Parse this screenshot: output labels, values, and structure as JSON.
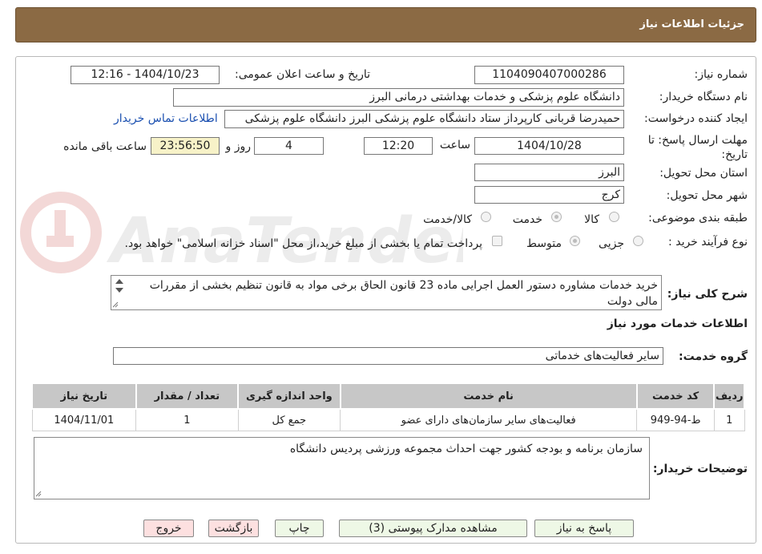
{
  "header": {
    "title": "جزئیات اطلاعات نیاز"
  },
  "form": {
    "need_number": {
      "label": "شماره نیاز:",
      "value": "1104090407000286"
    },
    "announce": {
      "label": "تاریخ و ساعت اعلان عمومی:",
      "value": "1404/10/23 - 12:16"
    },
    "buyer_org": {
      "label": "نام دستگاه خریدار:",
      "value": "دانشگاه علوم پزشکی و خدمات بهداشتی  درمانی البرز"
    },
    "requester": {
      "label": "ایجاد کننده درخواست:",
      "value": "حمیدرضا قربانی کارپرداز ستاد دانشگاه علوم پزشکی البرز دانشگاه علوم پزشکی"
    },
    "contact_link": "اطلاعات تماس خریدار",
    "deadline": {
      "label_line1": "مهلت ارسال پاسخ: تا",
      "label_line2": "تاریخ:",
      "date": "1404/10/28",
      "time_label": "ساعت",
      "time": "12:20",
      "days": "4",
      "days_label": "روز و",
      "remaining": "23:56:50",
      "remaining_label": "ساعت باقی مانده"
    },
    "province": {
      "label": "استان محل تحویل:",
      "value": "البرز"
    },
    "city": {
      "label": "شهر محل تحویل:",
      "value": "کرج"
    },
    "category": {
      "label": "طبقه بندی موضوعی:",
      "options": [
        "کالا",
        "خدمت",
        "کالا/خدمت"
      ],
      "selected": "خدمت"
    },
    "process": {
      "label": "نوع فرآیند خرید :",
      "options": [
        "جزیی",
        "متوسط"
      ],
      "selected": "متوسط",
      "payment_note": "پرداخت تمام یا بخشی از مبلغ خرید،از محل \"اسناد خزانه اسلامی\" خواهد بود."
    },
    "general_desc": {
      "label": "شرح کلی نیاز:",
      "value": "خرید خدمات مشاوره دستور العمل اجرایی ماده 23 قانون الحاق برخی مواد به قانون تنظیم بخشی از مقررات مالی دولت"
    }
  },
  "services": {
    "section_title": "اطلاعات خدمات مورد نیاز",
    "group_label": "گروه خدمت:",
    "group_value": "سایر فعالیت‌های خدماتی",
    "table": {
      "headers": [
        "ردیف",
        "کد خدمت",
        "نام خدمت",
        "واحد اندازه گیری",
        "تعداد / مقدار",
        "تاریخ نیاز"
      ],
      "rows": [
        [
          "1",
          "ط-94-949",
          "فعالیت‌های سایر سازمان‌های دارای عضو",
          "جمع کل",
          "1",
          "1404/11/01"
        ]
      ]
    }
  },
  "buyer_notes": {
    "label": "توضیحات خریدار:",
    "value": "سازمان برنامه و بودجه کشور جهت احداث مجموعه ورزشی پردیس دانشگاه"
  },
  "buttons": {
    "reply": "پاسخ به نیاز",
    "attachments": "مشاهده مدارک پیوستی (3)",
    "print": "چاپ",
    "back": "بازگشت",
    "exit": "خروج"
  },
  "colors": {
    "header_bg": "#8b6a44",
    "button_bg": "#eef8e6",
    "button_pink": "#fde0e0",
    "link": "#1a4fb0"
  }
}
